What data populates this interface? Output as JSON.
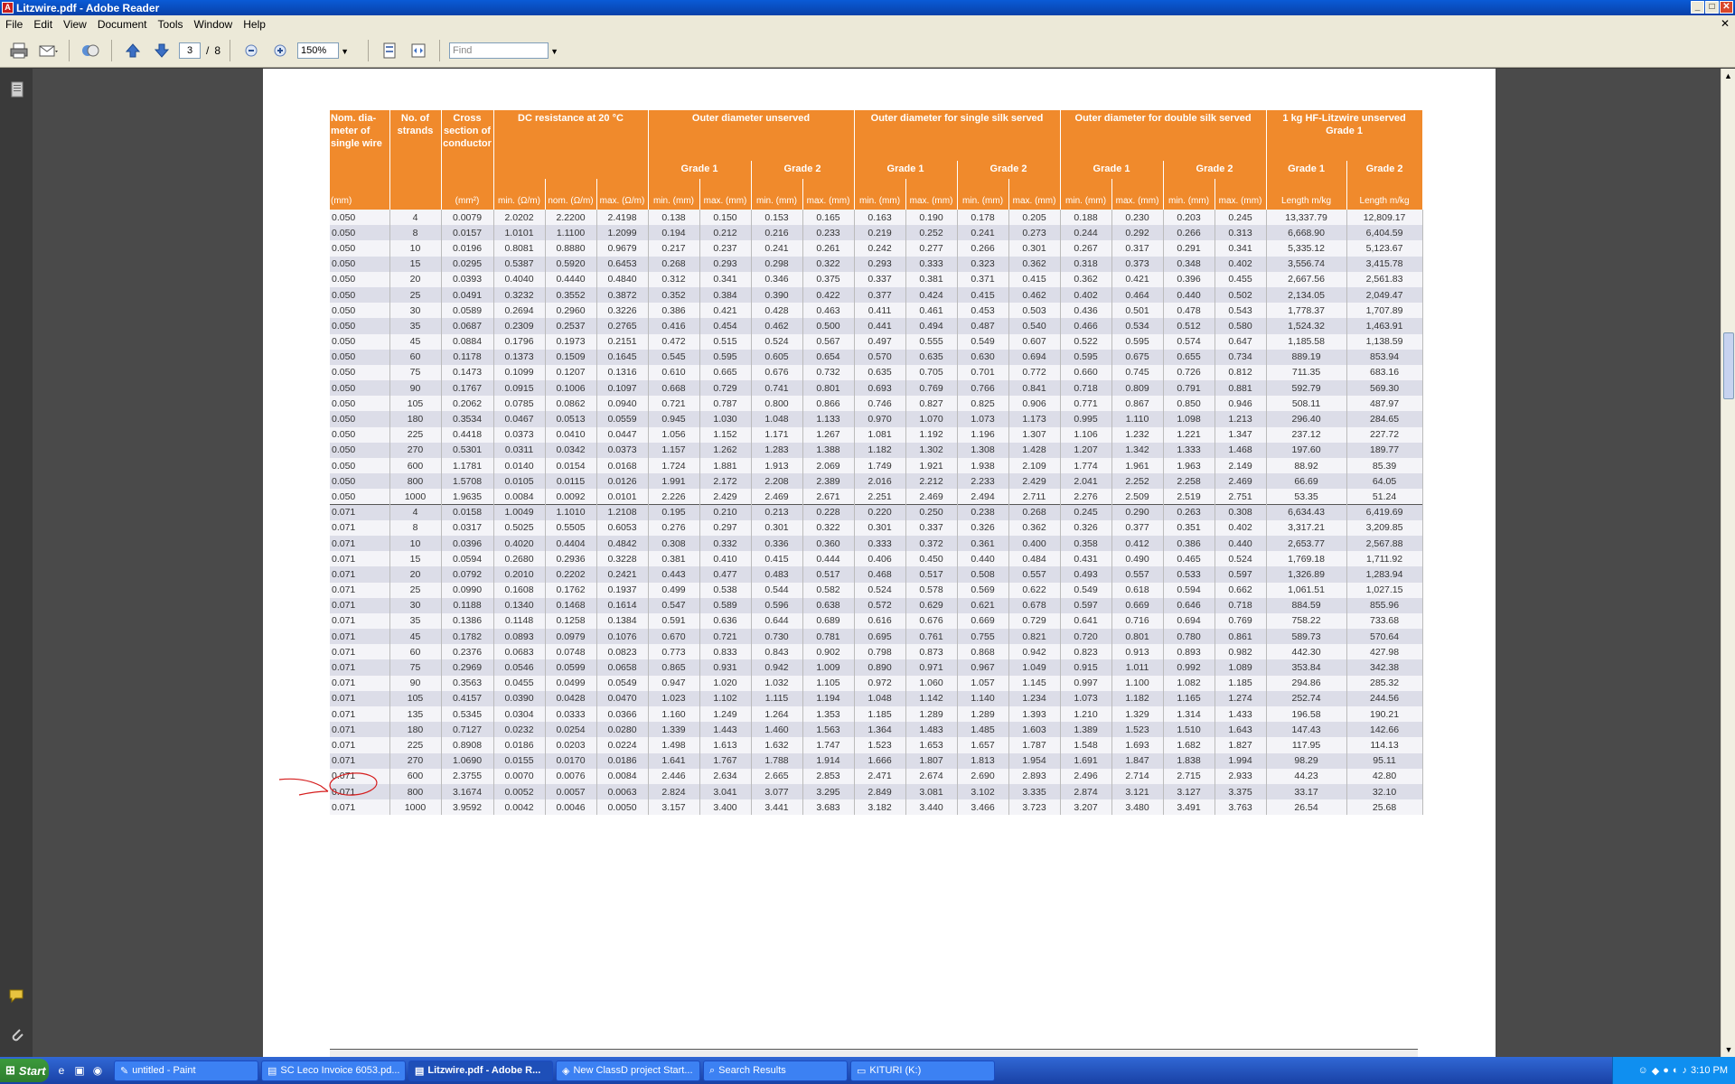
{
  "window": {
    "title": "Litzwire.pdf - Adobe Reader",
    "min": "_",
    "max": "□",
    "close": "✕"
  },
  "menu": [
    "File",
    "Edit",
    "View",
    "Document",
    "Tools",
    "Window",
    "Help"
  ],
  "menu_close": "✕",
  "toolbar": {
    "page_current": "3",
    "page_sep": "/",
    "page_total": "8",
    "zoom": "150%",
    "find_placeholder": "Find"
  },
  "table": {
    "headers": {
      "nom_dia": "Nom. dia-meter of single wire",
      "strands": "No. of strands",
      "cross": "Cross section of conductor",
      "dc": "DC resistance at 20 °C",
      "outer_unserved": "Outer diameter unserved",
      "outer_single": "Outer diameter for single silk served",
      "outer_double": "Outer diameter for double silk served",
      "hf": "1 kg HF-Litzwire unserved Grade 1",
      "grade1": "Grade 1",
      "grade2": "Grade 2"
    },
    "units": [
      "(mm)",
      "",
      "(mm²)",
      "min. (Ω/m)",
      "nom. (Ω/m)",
      "max. (Ω/m)",
      "min. (mm)",
      "max. (mm)",
      "min. (mm)",
      "max. (mm)",
      "min. (mm)",
      "max. (mm)",
      "min. (mm)",
      "max. (mm)",
      "min. (mm)",
      "max. (mm)",
      "min. (mm)",
      "max. (mm)",
      "Length m/kg",
      "Length m/kg"
    ],
    "rows": [
      [
        "0.050",
        "4",
        "0.0079",
        "2.0202",
        "2.2200",
        "2.4198",
        "0.138",
        "0.150",
        "0.153",
        "0.165",
        "0.163",
        "0.190",
        "0.178",
        "0.205",
        "0.188",
        "0.230",
        "0.203",
        "0.245",
        "13,337.79",
        "12,809.17"
      ],
      [
        "0.050",
        "8",
        "0.0157",
        "1.0101",
        "1.1100",
        "1.2099",
        "0.194",
        "0.212",
        "0.216",
        "0.233",
        "0.219",
        "0.252",
        "0.241",
        "0.273",
        "0.244",
        "0.292",
        "0.266",
        "0.313",
        "6,668.90",
        "6,404.59"
      ],
      [
        "0.050",
        "10",
        "0.0196",
        "0.8081",
        "0.8880",
        "0.9679",
        "0.217",
        "0.237",
        "0.241",
        "0.261",
        "0.242",
        "0.277",
        "0.266",
        "0.301",
        "0.267",
        "0.317",
        "0.291",
        "0.341",
        "5,335.12",
        "5,123.67"
      ],
      [
        "0.050",
        "15",
        "0.0295",
        "0.5387",
        "0.5920",
        "0.6453",
        "0.268",
        "0.293",
        "0.298",
        "0.322",
        "0.293",
        "0.333",
        "0.323",
        "0.362",
        "0.318",
        "0.373",
        "0.348",
        "0.402",
        "3,556.74",
        "3,415.78"
      ],
      [
        "0.050",
        "20",
        "0.0393",
        "0.4040",
        "0.4440",
        "0.4840",
        "0.312",
        "0.341",
        "0.346",
        "0.375",
        "0.337",
        "0.381",
        "0.371",
        "0.415",
        "0.362",
        "0.421",
        "0.396",
        "0.455",
        "2,667.56",
        "2,561.83"
      ],
      [
        "0.050",
        "25",
        "0.0491",
        "0.3232",
        "0.3552",
        "0.3872",
        "0.352",
        "0.384",
        "0.390",
        "0.422",
        "0.377",
        "0.424",
        "0.415",
        "0.462",
        "0.402",
        "0.464",
        "0.440",
        "0.502",
        "2,134.05",
        "2,049.47"
      ],
      [
        "0.050",
        "30",
        "0.0589",
        "0.2694",
        "0.2960",
        "0.3226",
        "0.386",
        "0.421",
        "0.428",
        "0.463",
        "0.411",
        "0.461",
        "0.453",
        "0.503",
        "0.436",
        "0.501",
        "0.478",
        "0.543",
        "1,778.37",
        "1,707.89"
      ],
      [
        "0.050",
        "35",
        "0.0687",
        "0.2309",
        "0.2537",
        "0.2765",
        "0.416",
        "0.454",
        "0.462",
        "0.500",
        "0.441",
        "0.494",
        "0.487",
        "0.540",
        "0.466",
        "0.534",
        "0.512",
        "0.580",
        "1,524.32",
        "1,463.91"
      ],
      [
        "0.050",
        "45",
        "0.0884",
        "0.1796",
        "0.1973",
        "0.2151",
        "0.472",
        "0.515",
        "0.524",
        "0.567",
        "0.497",
        "0.555",
        "0.549",
        "0.607",
        "0.522",
        "0.595",
        "0.574",
        "0.647",
        "1,185.58",
        "1,138.59"
      ],
      [
        "0.050",
        "60",
        "0.1178",
        "0.1373",
        "0.1509",
        "0.1645",
        "0.545",
        "0.595",
        "0.605",
        "0.654",
        "0.570",
        "0.635",
        "0.630",
        "0.694",
        "0.595",
        "0.675",
        "0.655",
        "0.734",
        "889.19",
        "853.94"
      ],
      [
        "0.050",
        "75",
        "0.1473",
        "0.1099",
        "0.1207",
        "0.1316",
        "0.610",
        "0.665",
        "0.676",
        "0.732",
        "0.635",
        "0.705",
        "0.701",
        "0.772",
        "0.660",
        "0.745",
        "0.726",
        "0.812",
        "711.35",
        "683.16"
      ],
      [
        "0.050",
        "90",
        "0.1767",
        "0.0915",
        "0.1006",
        "0.1097",
        "0.668",
        "0.729",
        "0.741",
        "0.801",
        "0.693",
        "0.769",
        "0.766",
        "0.841",
        "0.718",
        "0.809",
        "0.791",
        "0.881",
        "592.79",
        "569.30"
      ],
      [
        "0.050",
        "105",
        "0.2062",
        "0.0785",
        "0.0862",
        "0.0940",
        "0.721",
        "0.787",
        "0.800",
        "0.866",
        "0.746",
        "0.827",
        "0.825",
        "0.906",
        "0.771",
        "0.867",
        "0.850",
        "0.946",
        "508.11",
        "487.97"
      ],
      [
        "0.050",
        "180",
        "0.3534",
        "0.0467",
        "0.0513",
        "0.0559",
        "0.945",
        "1.030",
        "1.048",
        "1.133",
        "0.970",
        "1.070",
        "1.073",
        "1.173",
        "0.995",
        "1.110",
        "1.098",
        "1.213",
        "296.40",
        "284.65"
      ],
      [
        "0.050",
        "225",
        "0.4418",
        "0.0373",
        "0.0410",
        "0.0447",
        "1.056",
        "1.152",
        "1.171",
        "1.267",
        "1.081",
        "1.192",
        "1.196",
        "1.307",
        "1.106",
        "1.232",
        "1.221",
        "1.347",
        "237.12",
        "227.72"
      ],
      [
        "0.050",
        "270",
        "0.5301",
        "0.0311",
        "0.0342",
        "0.0373",
        "1.157",
        "1.262",
        "1.283",
        "1.388",
        "1.182",
        "1.302",
        "1.308",
        "1.428",
        "1.207",
        "1.342",
        "1.333",
        "1.468",
        "197.60",
        "189.77"
      ],
      [
        "0.050",
        "600",
        "1.1781",
        "0.0140",
        "0.0154",
        "0.0168",
        "1.724",
        "1.881",
        "1.913",
        "2.069",
        "1.749",
        "1.921",
        "1.938",
        "2.109",
        "1.774",
        "1.961",
        "1.963",
        "2.149",
        "88.92",
        "85.39"
      ],
      [
        "0.050",
        "800",
        "1.5708",
        "0.0105",
        "0.0115",
        "0.0126",
        "1.991",
        "2.172",
        "2.208",
        "2.389",
        "2.016",
        "2.212",
        "2.233",
        "2.429",
        "2.041",
        "2.252",
        "2.258",
        "2.469",
        "66.69",
        "64.05"
      ],
      [
        "0.050",
        "1000",
        "1.9635",
        "0.0084",
        "0.0092",
        "0.0101",
        "2.226",
        "2.429",
        "2.469",
        "2.671",
        "2.251",
        "2.469",
        "2.494",
        "2.711",
        "2.276",
        "2.509",
        "2.519",
        "2.751",
        "53.35",
        "51.24"
      ],
      [
        "0.071",
        "4",
        "0.0158",
        "1.0049",
        "1.1010",
        "1.2108",
        "0.195",
        "0.210",
        "0.213",
        "0.228",
        "0.220",
        "0.250",
        "0.238",
        "0.268",
        "0.245",
        "0.290",
        "0.263",
        "0.308",
        "6,634.43",
        "6,419.69"
      ],
      [
        "0.071",
        "8",
        "0.0317",
        "0.5025",
        "0.5505",
        "0.6053",
        "0.276",
        "0.297",
        "0.301",
        "0.322",
        "0.301",
        "0.337",
        "0.326",
        "0.362",
        "0.326",
        "0.377",
        "0.351",
        "0.402",
        "3,317.21",
        "3,209.85"
      ],
      [
        "0.071",
        "10",
        "0.0396",
        "0.4020",
        "0.4404",
        "0.4842",
        "0.308",
        "0.332",
        "0.336",
        "0.360",
        "0.333",
        "0.372",
        "0.361",
        "0.400",
        "0.358",
        "0.412",
        "0.386",
        "0.440",
        "2,653.77",
        "2,567.88"
      ],
      [
        "0.071",
        "15",
        "0.0594",
        "0.2680",
        "0.2936",
        "0.3228",
        "0.381",
        "0.410",
        "0.415",
        "0.444",
        "0.406",
        "0.450",
        "0.440",
        "0.484",
        "0.431",
        "0.490",
        "0.465",
        "0.524",
        "1,769.18",
        "1,711.92"
      ],
      [
        "0.071",
        "20",
        "0.0792",
        "0.2010",
        "0.2202",
        "0.2421",
        "0.443",
        "0.477",
        "0.483",
        "0.517",
        "0.468",
        "0.517",
        "0.508",
        "0.557",
        "0.493",
        "0.557",
        "0.533",
        "0.597",
        "1,326.89",
        "1,283.94"
      ],
      [
        "0.071",
        "25",
        "0.0990",
        "0.1608",
        "0.1762",
        "0.1937",
        "0.499",
        "0.538",
        "0.544",
        "0.582",
        "0.524",
        "0.578",
        "0.569",
        "0.622",
        "0.549",
        "0.618",
        "0.594",
        "0.662",
        "1,061.51",
        "1,027.15"
      ],
      [
        "0.071",
        "30",
        "0.1188",
        "0.1340",
        "0.1468",
        "0.1614",
        "0.547",
        "0.589",
        "0.596",
        "0.638",
        "0.572",
        "0.629",
        "0.621",
        "0.678",
        "0.597",
        "0.669",
        "0.646",
        "0.718",
        "884.59",
        "855.96"
      ],
      [
        "0.071",
        "35",
        "0.1386",
        "0.1148",
        "0.1258",
        "0.1384",
        "0.591",
        "0.636",
        "0.644",
        "0.689",
        "0.616",
        "0.676",
        "0.669",
        "0.729",
        "0.641",
        "0.716",
        "0.694",
        "0.769",
        "758.22",
        "733.68"
      ],
      [
        "0.071",
        "45",
        "0.1782",
        "0.0893",
        "0.0979",
        "0.1076",
        "0.670",
        "0.721",
        "0.730",
        "0.781",
        "0.695",
        "0.761",
        "0.755",
        "0.821",
        "0.720",
        "0.801",
        "0.780",
        "0.861",
        "589.73",
        "570.64"
      ],
      [
        "0.071",
        "60",
        "0.2376",
        "0.0683",
        "0.0748",
        "0.0823",
        "0.773",
        "0.833",
        "0.843",
        "0.902",
        "0.798",
        "0.873",
        "0.868",
        "0.942",
        "0.823",
        "0.913",
        "0.893",
        "0.982",
        "442.30",
        "427.98"
      ],
      [
        "0.071",
        "75",
        "0.2969",
        "0.0546",
        "0.0599",
        "0.0658",
        "0.865",
        "0.931",
        "0.942",
        "1.009",
        "0.890",
        "0.971",
        "0.967",
        "1.049",
        "0.915",
        "1.011",
        "0.992",
        "1.089",
        "353.84",
        "342.38"
      ],
      [
        "0.071",
        "90",
        "0.3563",
        "0.0455",
        "0.0499",
        "0.0549",
        "0.947",
        "1.020",
        "1.032",
        "1.105",
        "0.972",
        "1.060",
        "1.057",
        "1.145",
        "0.997",
        "1.100",
        "1.082",
        "1.185",
        "294.86",
        "285.32"
      ],
      [
        "0.071",
        "105",
        "0.4157",
        "0.0390",
        "0.0428",
        "0.0470",
        "1.023",
        "1.102",
        "1.115",
        "1.194",
        "1.048",
        "1.142",
        "1.140",
        "1.234",
        "1.073",
        "1.182",
        "1.165",
        "1.274",
        "252.74",
        "244.56"
      ],
      [
        "0.071",
        "135",
        "0.5345",
        "0.0304",
        "0.0333",
        "0.0366",
        "1.160",
        "1.249",
        "1.264",
        "1.353",
        "1.185",
        "1.289",
        "1.289",
        "1.393",
        "1.210",
        "1.329",
        "1.314",
        "1.433",
        "196.58",
        "190.21"
      ],
      [
        "0.071",
        "180",
        "0.7127",
        "0.0232",
        "0.0254",
        "0.0280",
        "1.339",
        "1.443",
        "1.460",
        "1.563",
        "1.364",
        "1.483",
        "1.485",
        "1.603",
        "1.389",
        "1.523",
        "1.510",
        "1.643",
        "147.43",
        "142.66"
      ],
      [
        "0.071",
        "225",
        "0.8908",
        "0.0186",
        "0.0203",
        "0.0224",
        "1.498",
        "1.613",
        "1.632",
        "1.747",
        "1.523",
        "1.653",
        "1.657",
        "1.787",
        "1.548",
        "1.693",
        "1.682",
        "1.827",
        "117.95",
        "114.13"
      ],
      [
        "0.071",
        "270",
        "1.0690",
        "0.0155",
        "0.0170",
        "0.0186",
        "1.641",
        "1.767",
        "1.788",
        "1.914",
        "1.666",
        "1.807",
        "1.813",
        "1.954",
        "1.691",
        "1.847",
        "1.838",
        "1.994",
        "98.29",
        "95.11"
      ],
      [
        "0.071",
        "600",
        "2.3755",
        "0.0070",
        "0.0076",
        "0.0084",
        "2.446",
        "2.634",
        "2.665",
        "2.853",
        "2.471",
        "2.674",
        "2.690",
        "2.893",
        "2.496",
        "2.714",
        "2.715",
        "2.933",
        "44.23",
        "42.80"
      ],
      [
        "0.071",
        "800",
        "3.1674",
        "0.0052",
        "0.0057",
        "0.0063",
        "2.824",
        "3.041",
        "3.077",
        "3.295",
        "2.849",
        "3.081",
        "3.102",
        "3.335",
        "2.874",
        "3.121",
        "3.127",
        "3.375",
        "33.17",
        "32.10"
      ],
      [
        "0.071",
        "1000",
        "3.9592",
        "0.0042",
        "0.0046",
        "0.0050",
        "3.157",
        "3.400",
        "3.441",
        "3.683",
        "3.182",
        "3.440",
        "3.466",
        "3.723",
        "3.207",
        "3.480",
        "3.491",
        "3.763",
        "26.54",
        "25.68"
      ]
    ]
  },
  "taskbar": {
    "start": "Start",
    "tasks": [
      {
        "label": "untitled - Paint",
        "active": false
      },
      {
        "label": "SC Leco Invoice 6053.pd...",
        "active": false
      },
      {
        "label": "Litzwire.pdf - Adobe R...",
        "active": true
      },
      {
        "label": "New ClassD project Start...",
        "active": false
      },
      {
        "label": "Search Results",
        "active": false
      },
      {
        "label": "KITURI (K:)",
        "active": false
      }
    ],
    "clock": "3:10 PM"
  }
}
